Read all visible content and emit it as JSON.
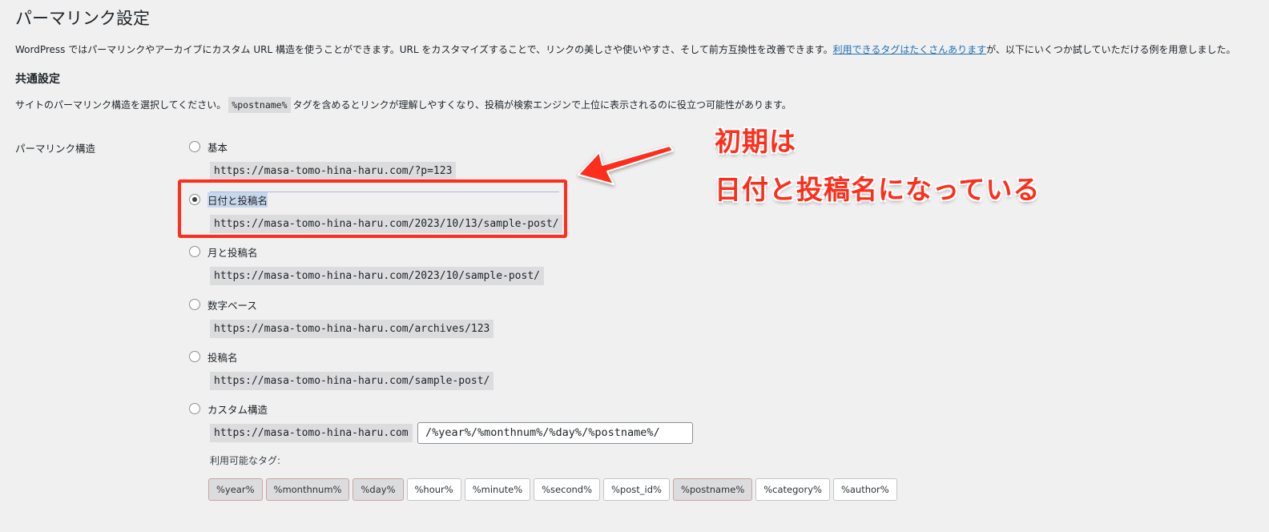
{
  "page": {
    "title": "パーマリンク設定"
  },
  "intro": {
    "text_before": "WordPress ではパーマリンクやアーカイブにカスタム URL 構造を使うことができます。URL をカスタマイズすることで、リンクの美しさや使いやすさ、そして前方互換性を改善できます。",
    "link": "利用できるタグはたくさんあります",
    "text_after": "が、以下にいくつか試していただける例を用意しました。"
  },
  "common": {
    "heading": "共通設定",
    "desc_before": "サイトのパーマリンク構造を選択してください。",
    "desc_code": "%postname%",
    "desc_after": "タグを含めるとリンクが理解しやすくなり、投稿が検索エンジンで上位に表示されるのに役立つ可能性があります。"
  },
  "permalink": {
    "field_label": "パーマリンク構造",
    "options": [
      {
        "label": "基本",
        "example": "https://masa-tomo-hina-haru.com/?p=123",
        "checked": false
      },
      {
        "label": "日付と投稿名",
        "example": "https://masa-tomo-hina-haru.com/2023/10/13/sample-post/",
        "checked": true
      },
      {
        "label": "月と投稿名",
        "example": "https://masa-tomo-hina-haru.com/2023/10/sample-post/",
        "checked": false
      },
      {
        "label": "数字ベース",
        "example": "https://masa-tomo-hina-haru.com/archives/123",
        "checked": false
      },
      {
        "label": "投稿名",
        "example": "https://masa-tomo-hina-haru.com/sample-post/",
        "checked": false
      },
      {
        "label": "カスタム構造",
        "example": "https://masa-tomo-hina-haru.com",
        "checked": false
      }
    ],
    "custom_value": "/%year%/%monthnum%/%day%/%postname%/",
    "tags_label": "利用可能なタグ:",
    "tags": [
      "%year%",
      "%monthnum%",
      "%day%",
      "%hour%",
      "%minute%",
      "%second%",
      "%post_id%",
      "%postname%",
      "%category%",
      "%author%"
    ],
    "active_tags": [
      "%year%",
      "%monthnum%",
      "%day%",
      "%postname%"
    ]
  },
  "annotation": {
    "line1": "初期は",
    "line2": "日付と投稿名になっている",
    "color": "#ff2d1a"
  }
}
